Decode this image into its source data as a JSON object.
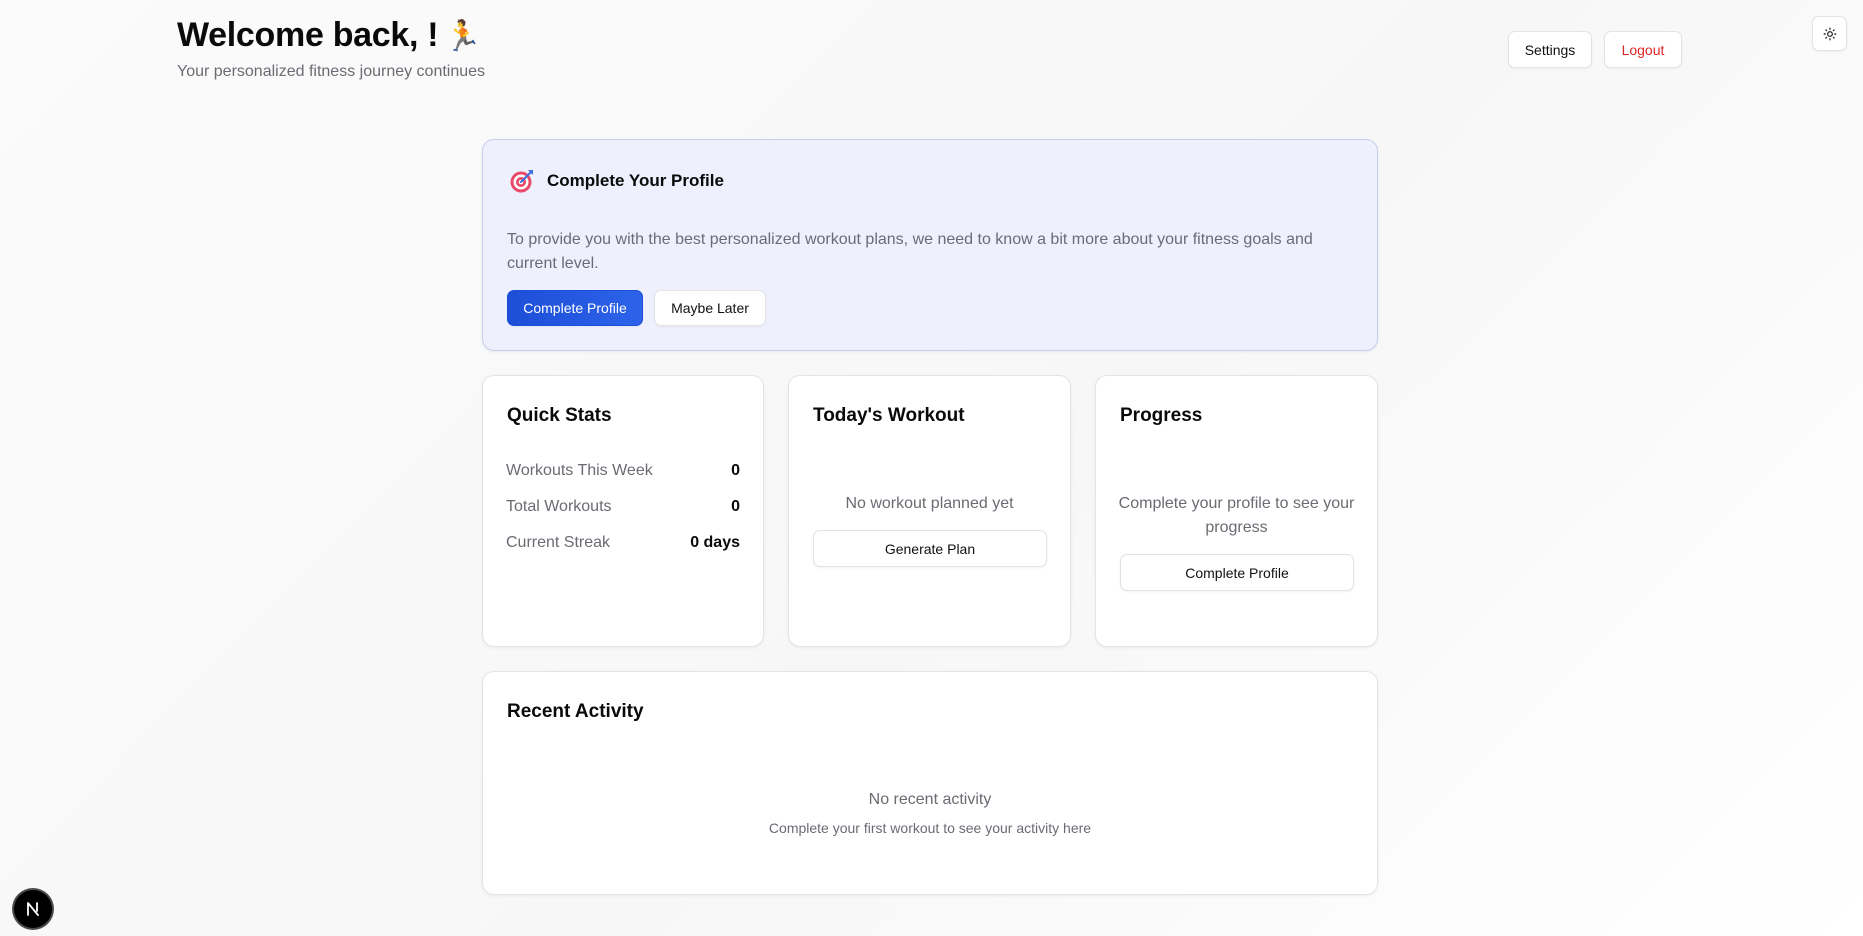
{
  "header": {
    "title": "Welcome back, !",
    "title_emoji": "🏃",
    "subtitle": "Your personalized fitness journey continues",
    "settings_label": "Settings",
    "logout_label": "Logout",
    "theme_toggle_icon": "sun-icon"
  },
  "profile_prompt": {
    "icon": "target-icon",
    "title": "Complete Your Profile",
    "description": "To provide you with the best personalized workout plans, we need to know a bit more about your fitness goals and current level.",
    "primary_button": "Complete Profile",
    "secondary_button": "Maybe Later"
  },
  "quick_stats": {
    "title": "Quick Stats",
    "rows": [
      {
        "label": "Workouts This Week",
        "value": "0"
      },
      {
        "label": "Total Workouts",
        "value": "0"
      },
      {
        "label": "Current Streak",
        "value": "0 days"
      }
    ]
  },
  "todays_workout": {
    "title": "Today's Workout",
    "empty_text": "No workout planned yet",
    "button": "Generate Plan"
  },
  "progress": {
    "title": "Progress",
    "empty_text": "Complete your profile to see your progress",
    "button": "Complete Profile"
  },
  "recent_activity": {
    "title": "Recent Activity",
    "empty_text": "No recent activity",
    "hint": "Complete your first workout to see your activity here"
  },
  "dev_indicator": {
    "label": "N"
  },
  "colors": {
    "primary": "#1d4ed8",
    "danger": "#dc2626",
    "profile_card_bg": "#eef1fd",
    "muted_text": "#6b6b73"
  }
}
